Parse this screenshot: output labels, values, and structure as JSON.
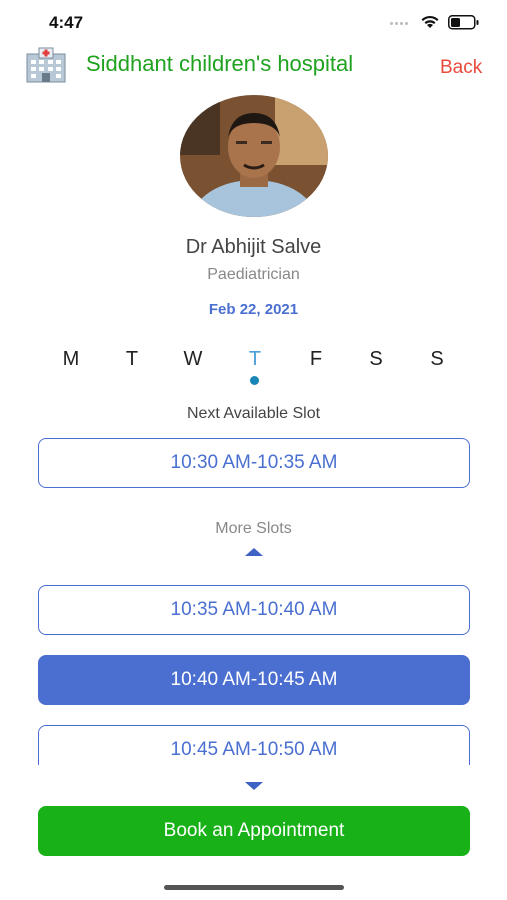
{
  "status_bar": {
    "time": "4:47",
    "icons": [
      "signal-dots-icon",
      "wifi-icon",
      "battery-icon"
    ]
  },
  "header": {
    "hospital_name": "Siddhant children's hospital",
    "back_label": "Back",
    "icon": "hospital-icon"
  },
  "doctor": {
    "name": "Dr Abhijit Salve",
    "specialty": "Paediatrician"
  },
  "date": "Feb 22, 2021",
  "week": {
    "days": [
      "M",
      "T",
      "W",
      "T",
      "F",
      "S",
      "S"
    ],
    "selected_index": 3
  },
  "next_available": {
    "label": "Next Available Slot",
    "slot": "10:30 AM-10:35 AM"
  },
  "more_slots": {
    "label": "More Slots",
    "slots": [
      "10:35 AM-10:40 AM",
      "10:40 AM-10:45 AM",
      "10:45 AM-10:50 AM"
    ],
    "selected_index": 1
  },
  "book_button_label": "Book an Appointment",
  "colors": {
    "hospital_name": "#1fa21f",
    "back": "#ea4a3c",
    "accent": "#4a6fd0",
    "book_button": "#18b118",
    "selected_day": "#4a9fd8"
  }
}
